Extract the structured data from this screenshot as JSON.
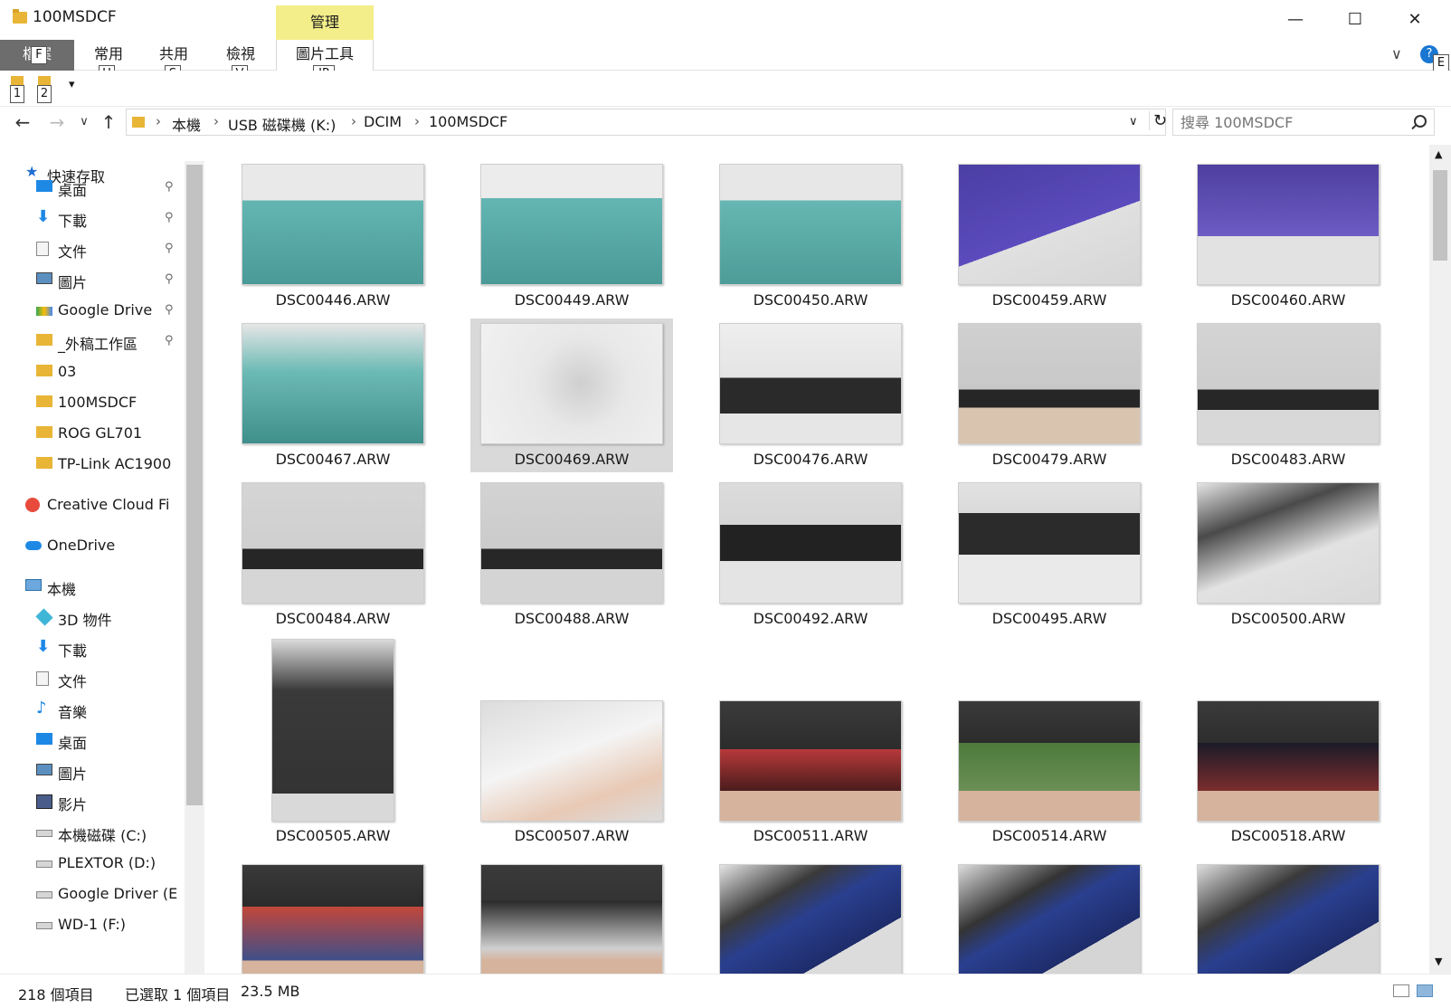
{
  "window": {
    "title": "100MSDCF",
    "manage_label": "管理",
    "minimize": "—",
    "maximize": "☐",
    "close": "✕"
  },
  "ribbon": {
    "tabs": [
      {
        "label": "檔案",
        "key": "F"
      },
      {
        "label": "常用",
        "key": "H"
      },
      {
        "label": "共用",
        "key": "S"
      },
      {
        "label": "檢視",
        "key": "V"
      },
      {
        "label": "圖片工具",
        "key": "JP"
      }
    ],
    "help_key": "E",
    "help_icon": "?",
    "collapse_icon": "∨"
  },
  "quick_access": {
    "keys": [
      "1",
      "2"
    ],
    "dropdown": "▾"
  },
  "nav": {
    "back": "←",
    "forward": "→",
    "recent": "∨",
    "up": "↑",
    "path": [
      "本機",
      "USB 磁碟機 (K:)",
      "DCIM",
      "100MSDCF"
    ],
    "separator": "›",
    "dropdown": "∨",
    "refresh": "↻"
  },
  "search": {
    "placeholder": "搜尋 100MSDCF"
  },
  "sidebar": {
    "items": [
      {
        "label": "快速存取",
        "icon": "star-icon",
        "pinned": false
      },
      {
        "label": "桌面",
        "icon": "desktop-icon",
        "pinned": true
      },
      {
        "label": "下載",
        "icon": "download-icon",
        "pinned": true
      },
      {
        "label": "文件",
        "icon": "document-icon",
        "pinned": true
      },
      {
        "label": "圖片",
        "icon": "pictures-icon",
        "pinned": true
      },
      {
        "label": "Google Drive",
        "icon": "google-drive-icon",
        "pinned": true
      },
      {
        "label": "_外稿工作區",
        "icon": "folder-icon",
        "pinned": true
      },
      {
        "label": "03",
        "icon": "folder-icon",
        "pinned": false
      },
      {
        "label": "100MSDCF",
        "icon": "folder-icon",
        "pinned": false
      },
      {
        "label": "ROG GL701",
        "icon": "folder-icon",
        "pinned": false
      },
      {
        "label": "TP-Link AC1900",
        "icon": "folder-icon",
        "pinned": false
      },
      {
        "label": "Creative Cloud Fi",
        "icon": "creative-cloud-icon",
        "pinned": false
      },
      {
        "label": "OneDrive",
        "icon": "onedrive-icon",
        "pinned": false
      },
      {
        "label": "本機",
        "icon": "computer-icon",
        "pinned": false
      },
      {
        "label": "3D 物件",
        "icon": "3d-objects-icon",
        "pinned": false
      },
      {
        "label": "下載",
        "icon": "download-icon",
        "pinned": false
      },
      {
        "label": "文件",
        "icon": "document-icon",
        "pinned": false
      },
      {
        "label": "音樂",
        "icon": "music-icon",
        "pinned": false
      },
      {
        "label": "桌面",
        "icon": "desktop-icon",
        "pinned": false
      },
      {
        "label": "圖片",
        "icon": "pictures-icon",
        "pinned": false
      },
      {
        "label": "影片",
        "icon": "video-icon",
        "pinned": false
      },
      {
        "label": "本機磁碟 (C:)",
        "icon": "drive-icon",
        "pinned": false
      },
      {
        "label": "PLEXTOR (D:)",
        "icon": "drive-icon",
        "pinned": false
      },
      {
        "label": "Google Driver (E",
        "icon": "drive-icon",
        "pinned": false
      },
      {
        "label": "WD-1 (F:)",
        "icon": "drive-icon",
        "pinned": false
      }
    ],
    "pin_glyph": "📌"
  },
  "files": [
    {
      "name": "DSC00446.ARW",
      "selected": false
    },
    {
      "name": "DSC00449.ARW",
      "selected": false
    },
    {
      "name": "DSC00450.ARW",
      "selected": false
    },
    {
      "name": "DSC00459.ARW",
      "selected": false
    },
    {
      "name": "DSC00460.ARW",
      "selected": false
    },
    {
      "name": "DSC00467.ARW",
      "selected": false
    },
    {
      "name": "DSC00469.ARW",
      "selected": true
    },
    {
      "name": "DSC00476.ARW",
      "selected": false
    },
    {
      "name": "DSC00479.ARW",
      "selected": false
    },
    {
      "name": "DSC00483.ARW",
      "selected": false
    },
    {
      "name": "DSC00484.ARW",
      "selected": false
    },
    {
      "name": "DSC00488.ARW",
      "selected": false
    },
    {
      "name": "DSC00492.ARW",
      "selected": false
    },
    {
      "name": "DSC00495.ARW",
      "selected": false
    },
    {
      "name": "DSC00500.ARW",
      "selected": false
    },
    {
      "name": "DSC00505.ARW",
      "selected": false
    },
    {
      "name": "DSC00507.ARW",
      "selected": false
    },
    {
      "name": "DSC00511.ARW",
      "selected": false
    },
    {
      "name": "DSC00514.ARW",
      "selected": false
    },
    {
      "name": "DSC00518.ARW",
      "selected": false
    },
    {
      "name": "",
      "selected": false
    },
    {
      "name": "",
      "selected": false
    },
    {
      "name": "",
      "selected": false
    },
    {
      "name": "",
      "selected": false
    },
    {
      "name": "",
      "selected": false
    }
  ],
  "status": {
    "item_count": "218 個項目",
    "selection": "已選取 1 個項目",
    "size": "23.5 MB"
  },
  "colors": {
    "manage_tab": "#f3ee8a",
    "file_tab": "#6d6d6d",
    "selection": "#d9d9d9",
    "folder": "#e8b536"
  }
}
